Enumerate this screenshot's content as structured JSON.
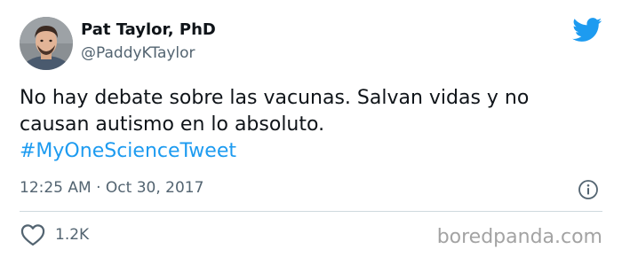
{
  "author": {
    "display_name": "Pat Taylor, PhD",
    "handle": "@PaddyKTaylor",
    "avatar_icon": "profile-photo"
  },
  "platform_icon": "twitter-bird-icon",
  "tweet": {
    "text_line_1": "No hay debate sobre las vacunas. Salvan vidas y no",
    "text_line_2": "causan autismo en lo absoluto.",
    "hashtag": "#MyOneScienceTweet"
  },
  "meta": {
    "time": "12:25 AM",
    "separator": "·",
    "date": "Oct 30, 2017",
    "info_icon": "info-icon"
  },
  "actions": {
    "like_icon": "heart-icon",
    "like_count": "1.2K"
  },
  "watermark": "boredpanda.com",
  "colors": {
    "text": "#0f1419",
    "secondary": "#536471",
    "accent": "#1d9bf0",
    "divider": "#cfd9de",
    "watermark": "#a3a3a3"
  }
}
